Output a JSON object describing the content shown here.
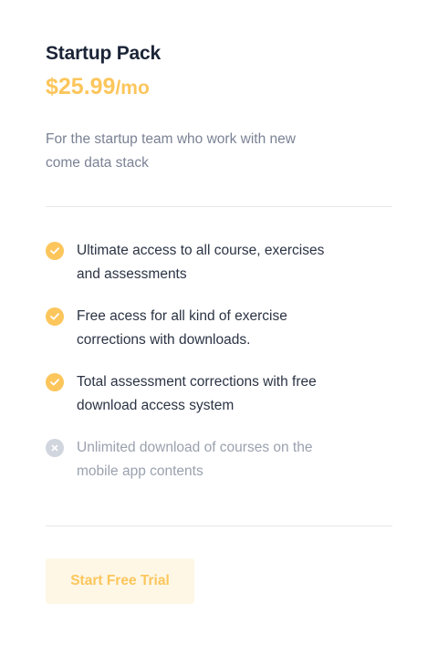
{
  "plan": {
    "title": "Startup Pack",
    "price_amount": "$25.99",
    "price_period": "/mo",
    "description": "For the startup team who work with new come data stack"
  },
  "features": [
    {
      "text": "Ultimate access to all course, exercises and assessments",
      "included": true,
      "icon": "check-icon"
    },
    {
      "text": "Free acess for all kind of exercise corrections with downloads.",
      "included": true,
      "icon": "check-icon"
    },
    {
      "text": "Total assessment corrections with free download access system",
      "included": true,
      "icon": "check-icon"
    },
    {
      "text": "Unlimited download of courses on the mobile app contents",
      "included": false,
      "icon": "close-icon"
    }
  ],
  "cta": {
    "label": "Start Free Trial"
  },
  "colors": {
    "accent": "#fcc65c",
    "accent_soft": "#fef7e6",
    "title": "#1b2437",
    "muted": "#7a8294",
    "disabled": "#d1d5de"
  }
}
